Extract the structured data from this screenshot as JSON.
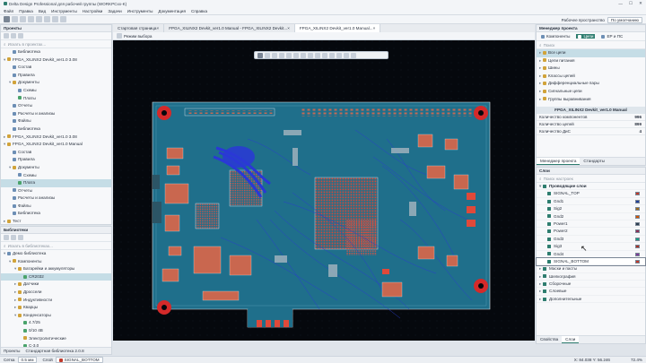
{
  "window": {
    "title": "Delta Design Professional для рабочей группы (WORKPCxx-K)",
    "controls": [
      "—",
      "☐",
      "✕"
    ]
  },
  "menu": [
    "Файл",
    "Правка",
    "Вид",
    "Инструменты",
    "Настройки",
    "Задачи",
    "Инструменты",
    "Документация",
    "Справка"
  ],
  "workspace": {
    "label": "Рабочее пространство",
    "value": "По умолчанию"
  },
  "left_top": {
    "title": "Проекты",
    "search_placeholder": "Искать в проектах...",
    "items": [
      {
        "indent": 1,
        "label": "Библиотека",
        "icon": "book-icon",
        "color": "#6d8fb5"
      },
      {
        "indent": 0,
        "label": "FPGA_XILINX2 Devkit_ver1.0 3.08",
        "icon": "project-icon",
        "color": "#d1a33a",
        "arrow": "▾"
      },
      {
        "indent": 1,
        "label": "Состав",
        "icon": "list-icon",
        "color": "#6d8fb5"
      },
      {
        "indent": 1,
        "label": "Правила",
        "icon": "rules-icon",
        "color": "#6d8fb5"
      },
      {
        "indent": 1,
        "label": "Документы",
        "icon": "folder-icon",
        "color": "#d1a33a",
        "arrow": "▾"
      },
      {
        "indent": 2,
        "label": "Схемы",
        "icon": "schematic-icon",
        "color": "#6d8fb5"
      },
      {
        "indent": 2,
        "label": "Платы",
        "icon": "pcb-icon",
        "color": "#4aa36b"
      },
      {
        "indent": 1,
        "label": "Отчеты",
        "icon": "report-icon",
        "color": "#6d8fb5"
      },
      {
        "indent": 1,
        "label": "Расчеты и анализы",
        "icon": "calc-icon",
        "color": "#6d8fb5"
      },
      {
        "indent": 1,
        "label": "Файлы",
        "icon": "file-icon",
        "color": "#6d8fb5"
      },
      {
        "indent": 1,
        "label": "Библиотека",
        "icon": "book-icon",
        "color": "#6d8fb5"
      },
      {
        "indent": 0,
        "label": "FPGA_XILINX2 Devkit_ver1.0 3.08",
        "icon": "project-icon",
        "color": "#d1a33a",
        "arrow": "▸"
      },
      {
        "indent": 0,
        "label": "FPGA_XILINX2 Devkit_ver1.0 Manual",
        "icon": "project-icon",
        "color": "#d1a33a",
        "arrow": "▾"
      },
      {
        "indent": 1,
        "label": "Состав",
        "icon": "list-icon",
        "color": "#6d8fb5"
      },
      {
        "indent": 1,
        "label": "Правила",
        "icon": "rules-icon",
        "color": "#6d8fb5"
      },
      {
        "indent": 1,
        "label": "Документы",
        "icon": "folder-icon",
        "color": "#d1a33a",
        "arrow": "▾"
      },
      {
        "indent": 2,
        "label": "Схемы",
        "icon": "schematic-icon",
        "color": "#6d8fb5"
      },
      {
        "indent": 2,
        "label": "Плата",
        "icon": "pcb-icon",
        "color": "#4aa36b",
        "selected": true
      },
      {
        "indent": 1,
        "label": "Отчеты",
        "icon": "report-icon",
        "color": "#6d8fb5"
      },
      {
        "indent": 1,
        "label": "Расчеты и анализы",
        "icon": "calc-icon",
        "color": "#6d8fb5"
      },
      {
        "indent": 1,
        "label": "Файлы",
        "icon": "file-icon",
        "color": "#6d8fb5"
      },
      {
        "indent": 1,
        "label": "Библиотека",
        "icon": "book-icon",
        "color": "#6d8fb5"
      },
      {
        "indent": 0,
        "label": "Тест",
        "icon": "project-icon",
        "color": "#d1a33a",
        "arrow": "▸"
      }
    ]
  },
  "left_bottom": {
    "title": "Библиотеки",
    "search_placeholder": "Искать в библиотеках...",
    "items": [
      {
        "indent": 0,
        "label": "Демо библиотека",
        "icon": "library-icon",
        "color": "#6d8fb5",
        "arrow": "▾"
      },
      {
        "indent": 1,
        "label": "Компоненты",
        "icon": "folder-icon",
        "color": "#d1a33a",
        "arrow": "▾"
      },
      {
        "indent": 2,
        "label": "Батарейки и аккумуляторы",
        "icon": "folder-icon",
        "color": "#d1a33a",
        "arrow": "▾"
      },
      {
        "indent": 3,
        "label": "CR2032",
        "icon": "component-icon",
        "color": "#4aa36b",
        "selected": true
      },
      {
        "indent": 2,
        "label": "Датчики",
        "icon": "folder-icon",
        "color": "#d1a33a",
        "arrow": "▸"
      },
      {
        "indent": 2,
        "label": "Дроссели",
        "icon": "folder-icon",
        "color": "#d1a33a",
        "arrow": "▸"
      },
      {
        "indent": 2,
        "label": "Индуктивности",
        "icon": "folder-icon",
        "color": "#d1a33a",
        "arrow": "▸"
      },
      {
        "indent": 2,
        "label": "Кварцы",
        "icon": "folder-icon",
        "color": "#d1a33a",
        "arrow": "▸"
      },
      {
        "indent": 2,
        "label": "Конденсаторы",
        "icon": "folder-icon",
        "color": "#d1a33a",
        "arrow": "▾"
      },
      {
        "indent": 3,
        "label": "4.7/25",
        "icon": "component-icon",
        "color": "#4aa36b"
      },
      {
        "indent": 3,
        "label": "0/10 4B",
        "icon": "component-icon",
        "color": "#4aa36b"
      },
      {
        "indent": 3,
        "label": "Электролитические",
        "icon": "folder-icon",
        "color": "#d1a33a"
      },
      {
        "indent": 3,
        "label": "С-3.0",
        "icon": "component-icon",
        "color": "#4aa36b"
      }
    ],
    "footer": {
      "tab1": "Проекты",
      "tab2": "Стандартная библиотека 2.0.8"
    }
  },
  "doc_tabs": [
    {
      "label": "Стартовая страница",
      "active": false
    },
    {
      "label": "FPGA_XILINX2 Devkit_ver1.0 Manual - FPGA_XILINX2 Devkit...",
      "active": false
    },
    {
      "label": "FPGA_XILINX2 Devkit_ver1.0 Manual...",
      "active": true
    }
  ],
  "subbar": {
    "label": "Режим выбора"
  },
  "right_top": {
    "title": "Менеджер проекта",
    "tabs": [
      "Компоненты",
      "Цепи",
      "ЕР и ПС"
    ],
    "active_tab": 1,
    "search_placeholder": "Поиск",
    "items": [
      {
        "label": "Все цепи",
        "selected": true
      },
      {
        "label": "Цепи питания"
      },
      {
        "label": "Шины"
      },
      {
        "label": "Классы цепей"
      },
      {
        "label": "Дифференциальные пары"
      },
      {
        "label": "Сигнальные цепи"
      },
      {
        "label": "Группы выравнивания"
      }
    ],
    "props_title": "FPGA_XILINX2 Devkit_ver1.0 Manual",
    "props": [
      {
        "label": "Количество компонентов",
        "value": "996"
      },
      {
        "label": "Количество цепей",
        "value": "899"
      },
      {
        "label": "Количество ДиС",
        "value": "4"
      }
    ],
    "bottom_tabs": [
      "Менеджер проекта",
      "Стандарты"
    ]
  },
  "right_bottom": {
    "title": "Слои",
    "search_placeholder": "Поиск настроек",
    "group": "Проводящие слои",
    "layers": [
      {
        "name": "SIGNAL_TOP",
        "color": "#c0392b",
        "sel": true
      },
      {
        "name": "Gnd1",
        "color": "#1f3f9a"
      },
      {
        "name": "Sig2",
        "color": "#9c6a1c"
      },
      {
        "name": "Gnd2",
        "color": "#d35400"
      },
      {
        "name": "Power1",
        "color": "#2c3e50"
      },
      {
        "name": "Power2",
        "color": "#8e2f55"
      },
      {
        "name": "Gnd3",
        "color": "#16a085"
      },
      {
        "name": "Sig3",
        "color": "#a93226"
      },
      {
        "name": "Gnd4",
        "color": "#7d3c98"
      },
      {
        "name": "SIGNAL_BOTTOM",
        "color": "#c0392b",
        "highlight": true
      }
    ],
    "others": [
      {
        "name": "Маски и пасты"
      },
      {
        "name": "Шелкография"
      },
      {
        "name": "Сборочные"
      },
      {
        "name": "Слоевые"
      },
      {
        "name": "Дополнительные"
      }
    ],
    "bottom_tabs": [
      "Свойства",
      "Слои"
    ]
  },
  "status": {
    "grid_label": "Сетка",
    "grid_value": "0.5 мм",
    "layer_label": "Слой",
    "layer_value": "SIGNAL_BOTTOM",
    "coords": "X: 84.038  Y: 56.246",
    "zoom": "72.4%"
  }
}
